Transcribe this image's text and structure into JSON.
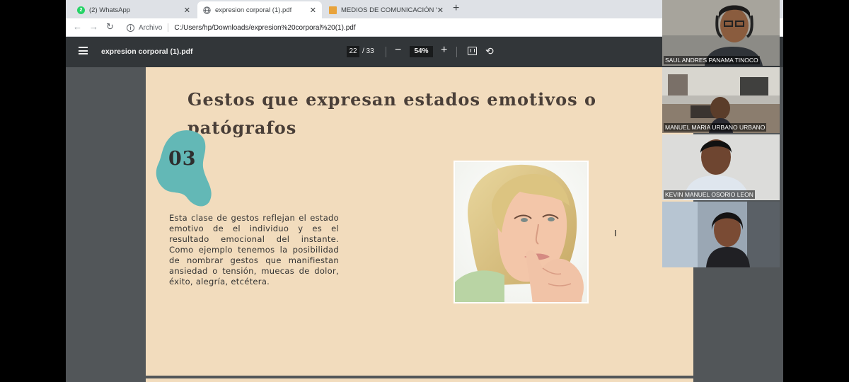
{
  "tabs": [
    {
      "label": "(2) WhatsApp",
      "icon": "whatsapp-icon",
      "badge": "2"
    },
    {
      "label": "expresion corporal (1).pdf",
      "icon": "globe-icon"
    },
    {
      "label": "MEDIOS DE COMUNICACIÓN Y S...",
      "icon": "slides-icon"
    }
  ],
  "tab_close": "✕",
  "new_tab": "+",
  "address": {
    "back": "←",
    "forward": "→",
    "reload": "↻",
    "info": "i",
    "scheme_label": "Archivo",
    "url": "C:/Users/hp/Downloads/expresion%20corporal%20(1).pdf"
  },
  "pdf_toolbar": {
    "title": "expresion corporal (1).pdf",
    "current_page": "22",
    "total_pages": "/ 33",
    "zoom_minus": "−",
    "zoom": "54%",
    "zoom_plus": "+",
    "rotate": "⟲"
  },
  "slide": {
    "title": "Gestos que expresan estados emotivos o patógrafos",
    "number": "03",
    "body": "Esta clase de gestos reflejan el estado emotivo de el individuo y es el resultado emocional del instante. Como ejemplo tenemos la posibilidad de nombrar gestos que manifiestan ansiedad o tensión, muecas de dolor, éxito, alegría, etcétera.",
    "blob_color": "#63b8b6"
  },
  "cursor": "I",
  "participants": [
    {
      "name": "SAUL ANDRES PANAMA TINOCO"
    },
    {
      "name": "MANUEL MARIA URBANO URBANO"
    },
    {
      "name": "KEVIN MANUEL OSORIO LEON"
    },
    {
      "name": ""
    }
  ],
  "scroll_down": "▼"
}
